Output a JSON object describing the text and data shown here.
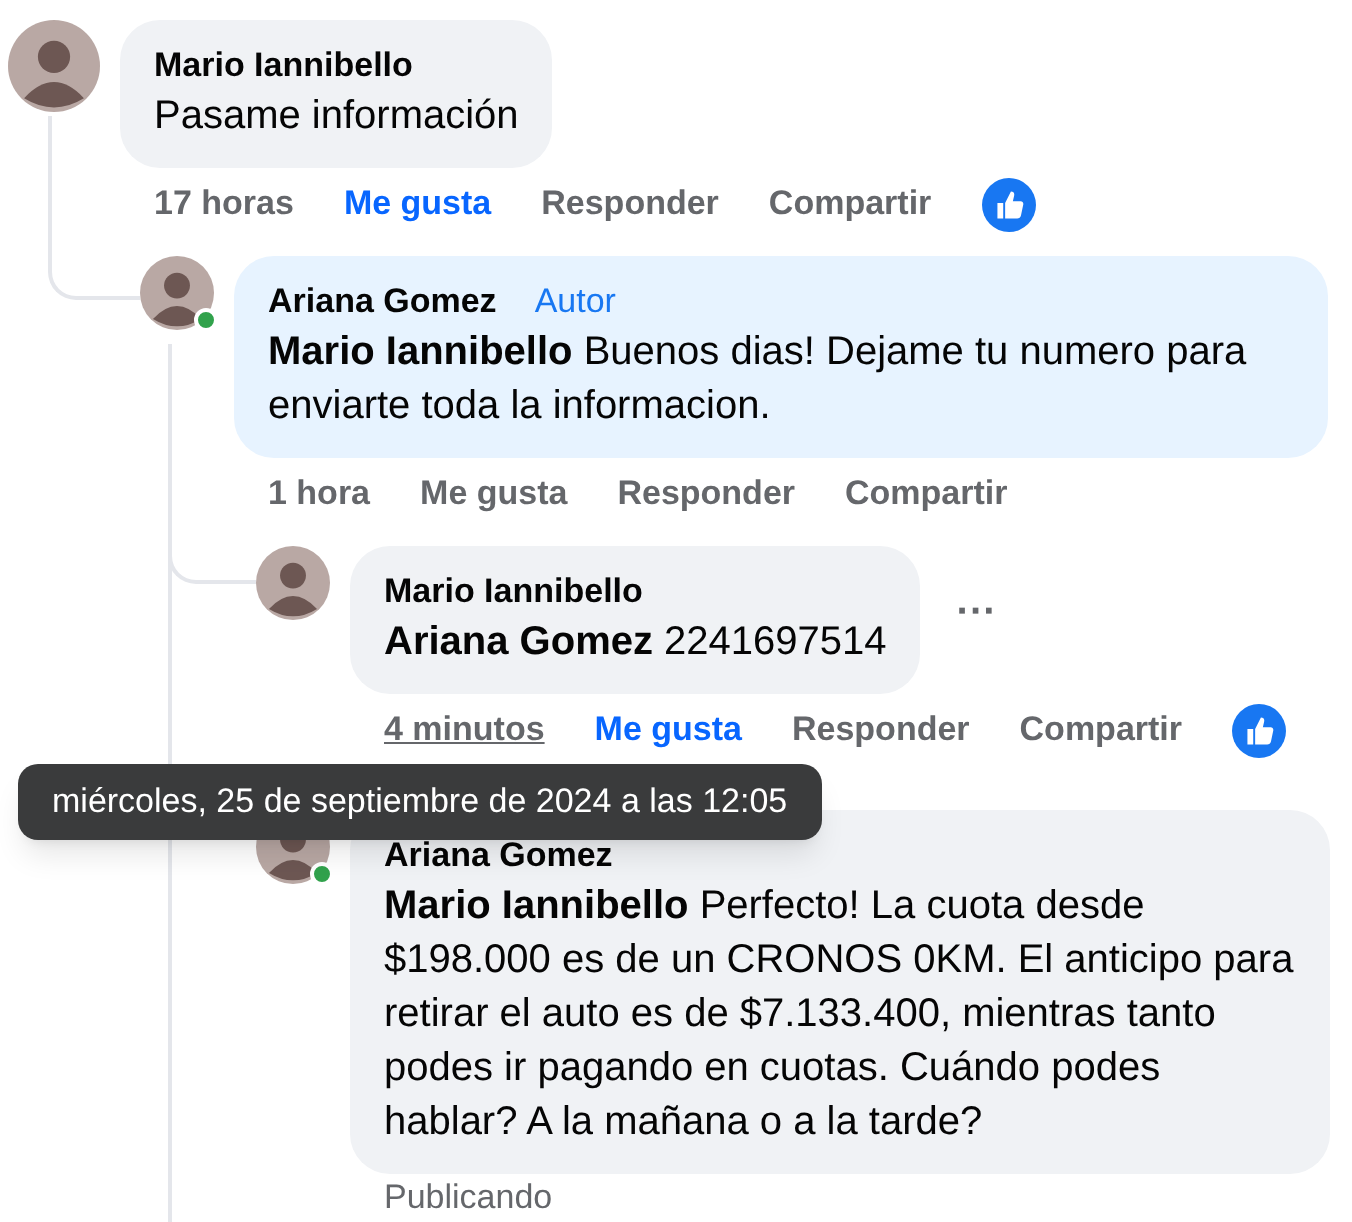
{
  "comments": [
    {
      "author": "Mario Iannibello",
      "text": "Pasame información",
      "time": "17 horas",
      "time_hovered": false,
      "like": "Me gusta",
      "liked": true,
      "reply": "Responder",
      "share": "Compartir",
      "reaction": true,
      "children": [
        {
          "author": "Ariana Gomez",
          "badge": "Autor",
          "mention": "Mario Iannibello",
          "text": "Buenos dias! Dejame tu numero para enviarte toda la informacion.",
          "online": true,
          "highlighted": true,
          "time": "1 hora",
          "time_hovered": false,
          "like": "Me gusta",
          "liked": false,
          "reply": "Responder",
          "share": "Compartir",
          "children": [
            {
              "author": "Mario Iannibello",
              "mention": "Ariana Gomez",
              "text": "2241697514",
              "time": "4 minutos",
              "time_hovered": true,
              "like": "Me gusta",
              "liked": true,
              "reply": "Responder",
              "share": "Compartir",
              "reaction": true,
              "more": "···"
            },
            {
              "author": "Ariana Gomez",
              "mention": "Mario Iannibello",
              "text": "Perfecto! La cuota desde $198.000 es de un CRONOS 0KM. El anticipo para retirar el auto es de $7.133.400, mientras tanto podes ir pagando en cuotas. Cuándo podes hablar? A la mañana o a la tarde?",
              "online": true,
              "status": "Publicando"
            }
          ]
        }
      ]
    }
  ],
  "tooltip": {
    "text": "miércoles, 25 de septiembre de 2024 a las 12:05"
  }
}
